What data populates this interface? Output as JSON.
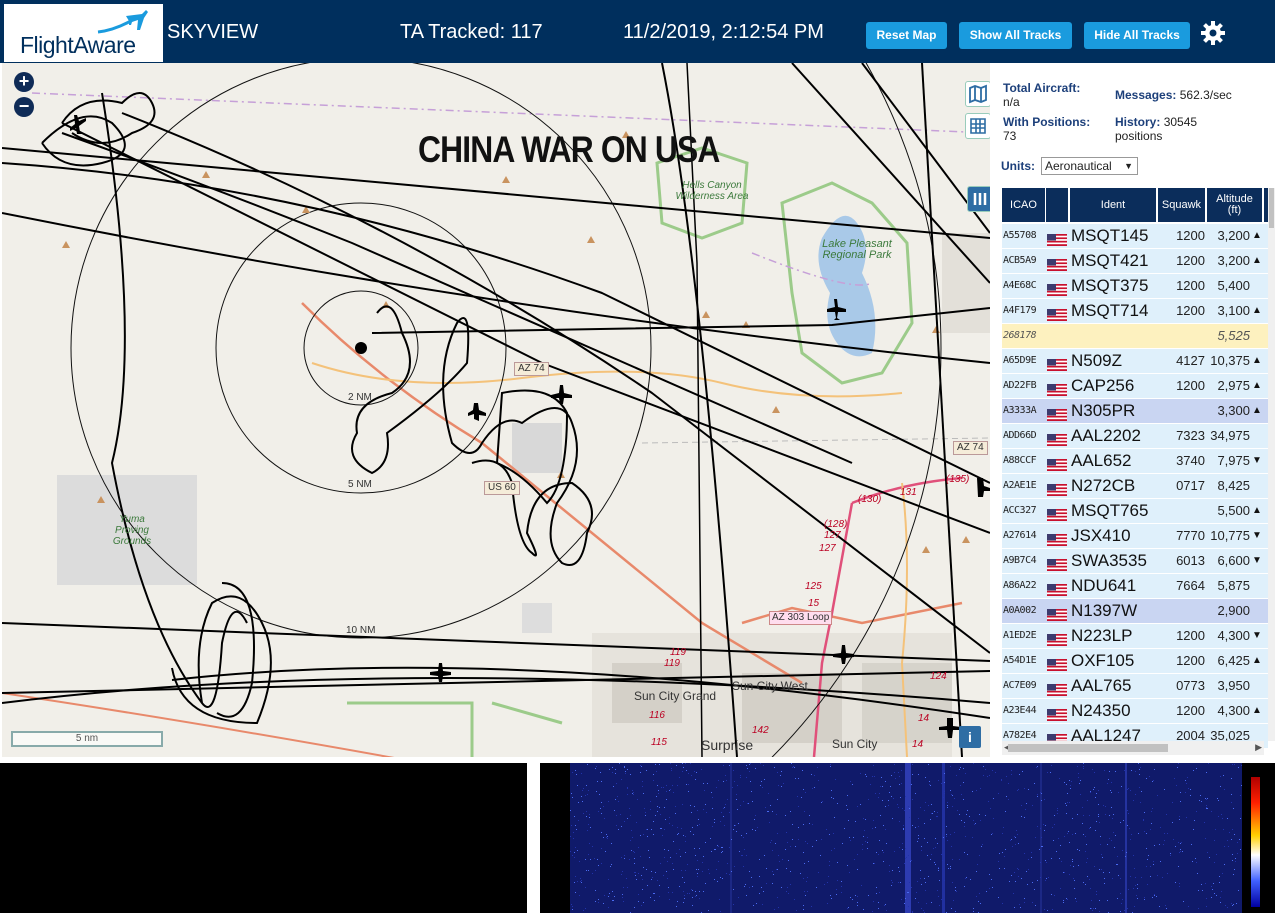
{
  "header": {
    "logo_text": "FlightAware",
    "site_title": "SKYVIEW",
    "tracked": "TA Tracked: 117",
    "datetime": "11/2/2019, 2:12:54 PM",
    "buttons": {
      "reset": "Reset Map",
      "show": "Show All Tracks",
      "hide": "Hide All Tracks"
    },
    "gear_icon": "gear-icon"
  },
  "map": {
    "banner": "CHINA WAR ON USA",
    "zoom_in": "+",
    "zoom_out": "−",
    "scale": "5 nm",
    "info": "i",
    "range_labels": [
      "2 NM",
      "5 NM",
      "10 NM"
    ],
    "parks": {
      "hells_canyon": "Hells Canyon Wilderness Area",
      "lake_pleasant": "Lake Pleasant Regional Park",
      "yuma": "Yuma Proving Grounds"
    },
    "roads": {
      "az74_a": "AZ 74",
      "az74_b": "AZ 74",
      "us60": "US 60",
      "az303": "AZ 303 Loop"
    },
    "cities": {
      "sun_city_grand": "Sun City Grand",
      "sun_city_west": "Sun City West",
      "surprise": "Surprise",
      "sun_city": "Sun City"
    },
    "exits": [
      "(130)",
      "131",
      "(135)",
      "(128)",
      "127",
      "127",
      "125",
      "15",
      "119",
      "119",
      "116",
      "115",
      "142",
      "14",
      "14",
      "124"
    ],
    "icons": [
      "layers-map-icon",
      "grid-icon",
      "columns-icon"
    ]
  },
  "sidebar": {
    "total_aircraft_label": "Total Aircraft:",
    "total_aircraft_value": "n/a",
    "with_positions_label": "With Positions:",
    "with_positions_value": "73",
    "messages_label": "Messages:",
    "messages_value": "562.3/sec",
    "history_label": "History:",
    "history_value": "30545",
    "history_unit": "positions",
    "units_label": "Units:",
    "units_value": "Aeronautical",
    "columns": {
      "icao": "ICAO",
      "ident": "Ident",
      "squawk": "Squawk",
      "alt1": "Altitude",
      "alt2": "(ft)"
    },
    "rows": [
      {
        "icao": "A55708",
        "flag": true,
        "ident": "MSQT145",
        "squawk": "1200",
        "alt": "3,200",
        "trend": "▲",
        "style": ""
      },
      {
        "icao": "ACB5A9",
        "flag": true,
        "ident": "MSQT421",
        "squawk": "1200",
        "alt": "3,200",
        "trend": "▲",
        "style": ""
      },
      {
        "icao": "A4E68C",
        "flag": true,
        "ident": "MSQT375",
        "squawk": "1200",
        "alt": "5,400",
        "trend": "",
        "style": ""
      },
      {
        "icao": "A4F179",
        "flag": true,
        "ident": "MSQT714",
        "squawk": "1200",
        "alt": "3,100",
        "trend": "▲",
        "style": ""
      },
      {
        "icao": "268178",
        "flag": false,
        "ident": "",
        "squawk": "",
        "alt": "5,525",
        "trend": "",
        "style": "yl"
      },
      {
        "icao": "A65D9E",
        "flag": true,
        "ident": "N509Z",
        "squawk": "4127",
        "alt": "10,375",
        "trend": "▲",
        "style": ""
      },
      {
        "icao": "AD22FB",
        "flag": true,
        "ident": "CAP256",
        "squawk": "1200",
        "alt": "2,975",
        "trend": "▲",
        "style": ""
      },
      {
        "icao": "A3333A",
        "flag": true,
        "ident": "N305PR",
        "squawk": "",
        "alt": "3,300",
        "trend": "▲",
        "style": "hl"
      },
      {
        "icao": "ADD66D",
        "flag": true,
        "ident": "AAL2202",
        "squawk": "7323",
        "alt": "34,975",
        "trend": "",
        "style": ""
      },
      {
        "icao": "A88CCF",
        "flag": true,
        "ident": "AAL652",
        "squawk": "3740",
        "alt": "7,975",
        "trend": "▼",
        "style": ""
      },
      {
        "icao": "A2AE1E",
        "flag": true,
        "ident": "N272CB",
        "squawk": "0717",
        "alt": "8,425",
        "trend": "",
        "style": ""
      },
      {
        "icao": "ACC327",
        "flag": true,
        "ident": "MSQT765",
        "squawk": "",
        "alt": "5,500",
        "trend": "▲",
        "style": ""
      },
      {
        "icao": "A27614",
        "flag": true,
        "ident": "JSX410",
        "squawk": "7770",
        "alt": "10,775",
        "trend": "▼",
        "style": ""
      },
      {
        "icao": "A9B7C4",
        "flag": true,
        "ident": "SWA3535",
        "squawk": "6013",
        "alt": "6,600",
        "trend": "▼",
        "style": ""
      },
      {
        "icao": "A86A22",
        "flag": true,
        "ident": "NDU641",
        "squawk": "7664",
        "alt": "5,875",
        "trend": "",
        "style": ""
      },
      {
        "icao": "A0A002",
        "flag": true,
        "ident": "N1397W",
        "squawk": "",
        "alt": "2,900",
        "trend": "",
        "style": "hl"
      },
      {
        "icao": "A1ED2E",
        "flag": true,
        "ident": "N223LP",
        "squawk": "1200",
        "alt": "4,300",
        "trend": "▼",
        "style": ""
      },
      {
        "icao": "A54D1E",
        "flag": true,
        "ident": "OXF105",
        "squawk": "1200",
        "alt": "6,425",
        "trend": "▲",
        "style": ""
      },
      {
        "icao": "AC7E09",
        "flag": true,
        "ident": "AAL765",
        "squawk": "0773",
        "alt": "3,950",
        "trend": "",
        "style": ""
      },
      {
        "icao": "A23E44",
        "flag": true,
        "ident": "N24350",
        "squawk": "1200",
        "alt": "4,300",
        "trend": "▲",
        "style": ""
      },
      {
        "icao": "A782E4",
        "flag": true,
        "ident": "AAL1247",
        "squawk": "2004",
        "alt": "35,025",
        "trend": "",
        "style": ""
      }
    ]
  },
  "colors": {
    "header_bg": "#002f5d",
    "button": "#1a9bde",
    "table_header": "#0b2d5b",
    "row_bg": "#dff0fb",
    "row_highlight": "#c9d5f2",
    "row_yellow": "#fdf1bf"
  }
}
